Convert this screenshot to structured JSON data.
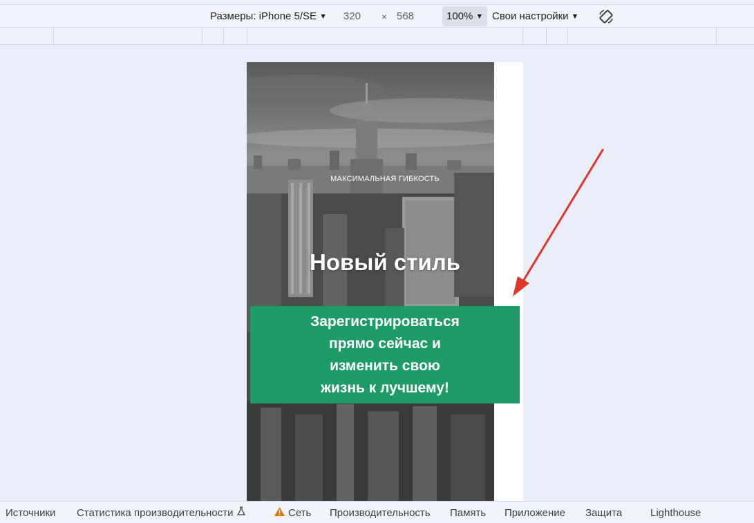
{
  "device_toolbar": {
    "device_label": "Размеры: iPhone 5/SE",
    "width": "320",
    "times": "×",
    "height": "568",
    "zoom": "100%",
    "throttle": "Свои настройки",
    "icons": {
      "caret": "caret-down-icon",
      "rotate": "rotate-icon"
    }
  },
  "page": {
    "eyebrow": "МАКСИМАЛЬНАЯ ГИБКОСТЬ",
    "title": "Новый стиль",
    "cta_lines": [
      "Зарегистрироваться",
      "прямо сейчас и",
      "изменить свою",
      "жизнь к лучшему!"
    ]
  },
  "panel_tabs": [
    {
      "label": "Источники"
    },
    {
      "label": "Статистика производительности",
      "icon": "flask-icon"
    },
    {
      "label": "Сеть",
      "icon": "warning-icon"
    },
    {
      "label": "Производительность"
    },
    {
      "label": "Память"
    },
    {
      "label": "Приложение"
    },
    {
      "label": "Защита"
    },
    {
      "label": "Lighthouse"
    }
  ],
  "colors": {
    "cta_background": "#1e9c67",
    "annotation_arrow": "#e0352b",
    "warning": "#e8710a"
  }
}
